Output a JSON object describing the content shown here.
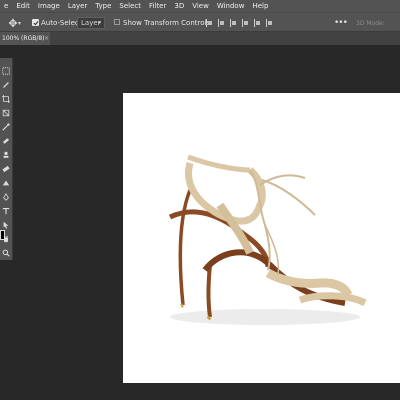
{
  "menubar": {
    "items": [
      "e",
      "Edit",
      "Image",
      "Layer",
      "Type",
      "Select",
      "Filter",
      "3D",
      "View",
      "Window",
      "Help"
    ]
  },
  "options_bar": {
    "tool_icon": "move-tool-icon",
    "auto_select_label": "Auto-Select:",
    "auto_select_checked": true,
    "auto_select_target": "Layer",
    "show_transform_controls_label": "Show Transform Controls",
    "show_transform_controls_checked": false,
    "more_icon": "ellipsis-icon",
    "mode_3d_label": "3D Mode:"
  },
  "document_tab": {
    "title": "100% (RGB/8)",
    "close_glyph": "×"
  },
  "toolbar": {
    "tools": [
      "marquee-icon",
      "brush-icon",
      "crop-icon",
      "frame-icon",
      "eyedropper-icon",
      "healing-icon",
      "stamp-icon",
      "eraser-icon",
      "gradient-icon",
      "pen-icon",
      "text-icon",
      "path-select-icon",
      "hand-icon",
      "zoom-icon"
    ]
  },
  "colors": {
    "app_bg": "#282828",
    "panel": "#535353",
    "canvas": "#ffffff",
    "shoe_suede": "#dbc7a4",
    "shoe_sole": "#8a4a23"
  },
  "canvas": {
    "content": "nude suede lace-up high-heel sandal"
  }
}
